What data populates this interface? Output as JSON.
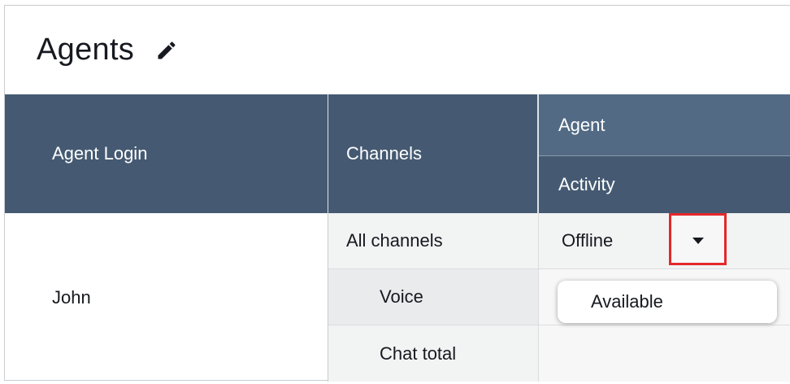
{
  "title": "Agents",
  "icons": {
    "edit": "pencil-icon",
    "dropdown": "caret-down-icon"
  },
  "colors": {
    "header_bg": "#455a72",
    "header_top_cell_bg": "#526a84",
    "highlight_border": "#e4282b",
    "text": "#16191f"
  },
  "table": {
    "headers": {
      "agent_login": "Agent Login",
      "channels": "Channels",
      "agent_activity_line1": "Agent",
      "agent_activity_line2": "Activity"
    },
    "rows": [
      {
        "agent": "John",
        "channels": [
          "All channels",
          "Voice",
          "Chat total"
        ],
        "activity": "Offline"
      }
    ]
  },
  "dropdown": {
    "options": [
      "Available"
    ]
  }
}
